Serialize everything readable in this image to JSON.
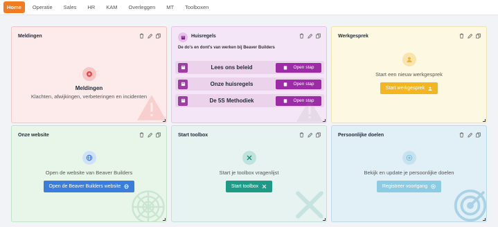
{
  "nav": {
    "tabs": [
      {
        "label": "Home",
        "active": true
      },
      {
        "label": "Operatie"
      },
      {
        "label": "Sales"
      },
      {
        "label": "HR"
      },
      {
        "label": "KAM"
      },
      {
        "label": "Overleggen"
      },
      {
        "label": "MT"
      },
      {
        "label": "Toolboxen"
      }
    ]
  },
  "cards": {
    "meldingen": {
      "title": "Meldingen",
      "heading": "Meldingen",
      "description": "Klachten, afwijkingen, verbeteringen en incidenten",
      "color": "#fdeaea"
    },
    "huisregels": {
      "title": "Huisregels",
      "subtitle": "De do's en dont's van werken bij Beaver Builders",
      "rows": [
        {
          "label": "Lees ons beleid",
          "button": "Open stap"
        },
        {
          "label": "Onze huisregels",
          "button": "Open stap"
        },
        {
          "label": "De 5S Methodiek",
          "button": "Open stap"
        }
      ],
      "color": "#f4e6f6"
    },
    "werkgesprek": {
      "title": "Werkgesprek",
      "description": "Start een nieuw werkgesprek",
      "button": "Start werkgesprek",
      "color": "#fdf8e1"
    },
    "website": {
      "title": "Onze website",
      "description": "Open de website van Beaver Builders",
      "button": "Open de Beaver Builders website",
      "color": "#e8f6ea"
    },
    "toolbox": {
      "title": "Start toolbox",
      "description": "Start je toolbox vragenlijst",
      "button": "Start toolbox",
      "color": "#e6f3f1"
    },
    "doelen": {
      "title": "Persoonlijke doelen",
      "description": "Bekijk en update je persoonlijke doelen",
      "button": "Registreer voortgang",
      "color": "#e1eff6"
    }
  }
}
